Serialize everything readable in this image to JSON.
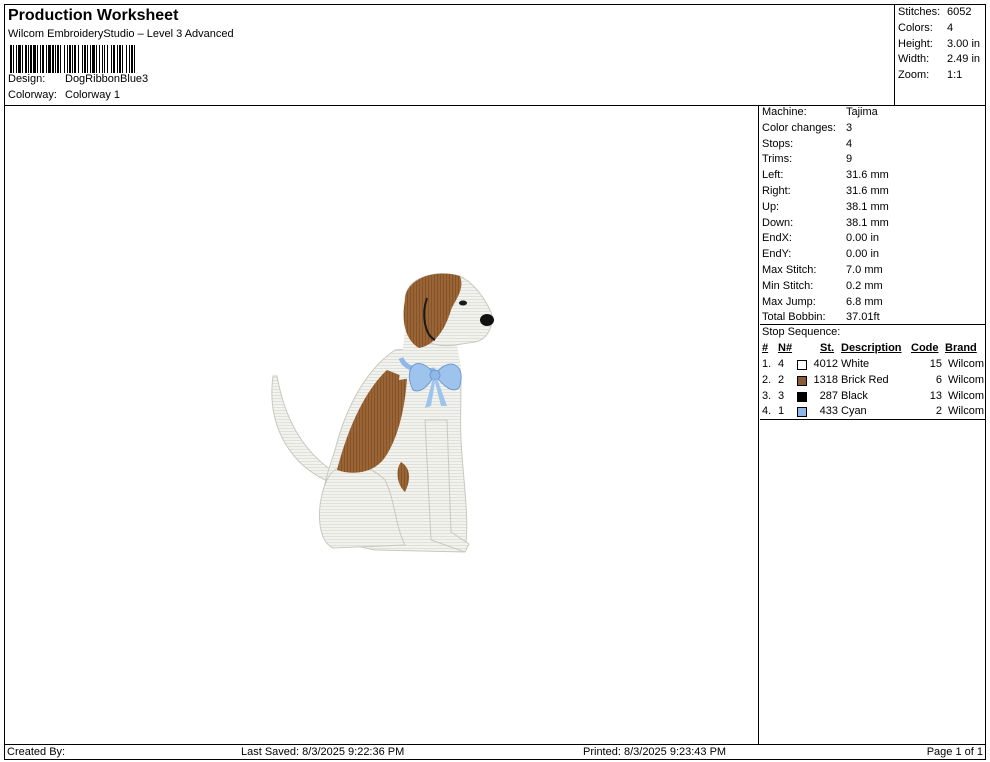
{
  "header": {
    "title": "Production Worksheet",
    "subtitle": "Wilcom EmbroideryStudio – Level 3 Advanced",
    "design_label": "Design:",
    "design_value": "DogRibbonBlue3",
    "colorway_label": "Colorway:",
    "colorway_value": "Colorway 1"
  },
  "stats": {
    "stitches_label": "Stitches:",
    "stitches_value": "6052",
    "colors_label": "Colors:",
    "colors_value": "4",
    "height_label": "Height:",
    "height_value": "3.00 in",
    "width_label": "Width:",
    "width_value": "2.49 in",
    "zoom_label": "Zoom:",
    "zoom_value": "1:1"
  },
  "machine": [
    {
      "k": "Machine:",
      "v": "Tajima"
    },
    {
      "k": "Color changes:",
      "v": "3"
    },
    {
      "k": "Stops:",
      "v": "4"
    },
    {
      "k": "Trims:",
      "v": "9"
    },
    {
      "k": "Left:",
      "v": "31.6 mm"
    },
    {
      "k": "Right:",
      "v": "31.6 mm"
    },
    {
      "k": "Up:",
      "v": "38.1 mm"
    },
    {
      "k": "Down:",
      "v": "38.1 mm"
    },
    {
      "k": "EndX:",
      "v": "0.00 in"
    },
    {
      "k": "EndY:",
      "v": "0.00 in"
    },
    {
      "k": "Max Stitch:",
      "v": "7.0 mm"
    },
    {
      "k": "Min Stitch:",
      "v": "0.2 mm"
    },
    {
      "k": "Max Jump:",
      "v": "6.8 mm"
    },
    {
      "k": "Total Bobbin:",
      "v": "37.01ft"
    }
  ],
  "stop_sequence": {
    "label": "Stop Sequence:",
    "headers": {
      "num": "#",
      "n": "N#",
      "st": "St.",
      "desc": "Description",
      "code": "Code",
      "brand": "Brand"
    },
    "rows": [
      {
        "num": "1.",
        "n": "4",
        "color": "#ffffff",
        "st": "4012",
        "desc": "White",
        "code": "15",
        "brand": "Wilcom"
      },
      {
        "num": "2.",
        "n": "2",
        "color": "#8b5a36",
        "st": "1318",
        "desc": "Brick Red",
        "code": "6",
        "brand": "Wilcom"
      },
      {
        "num": "3.",
        "n": "3",
        "color": "#000000",
        "st": "287",
        "desc": "Black",
        "code": "13",
        "brand": "Wilcom"
      },
      {
        "num": "4.",
        "n": "1",
        "color": "#8fb8e8",
        "st": "433",
        "desc": "Cyan",
        "code": "2",
        "brand": "Wilcom"
      }
    ]
  },
  "footer": {
    "created": "Created By:",
    "saved": "Last Saved: 8/3/2025 9:22:36 PM",
    "printed": "Printed: 8/3/2025 9:23:43 PM",
    "page": "Page 1 of 1"
  }
}
